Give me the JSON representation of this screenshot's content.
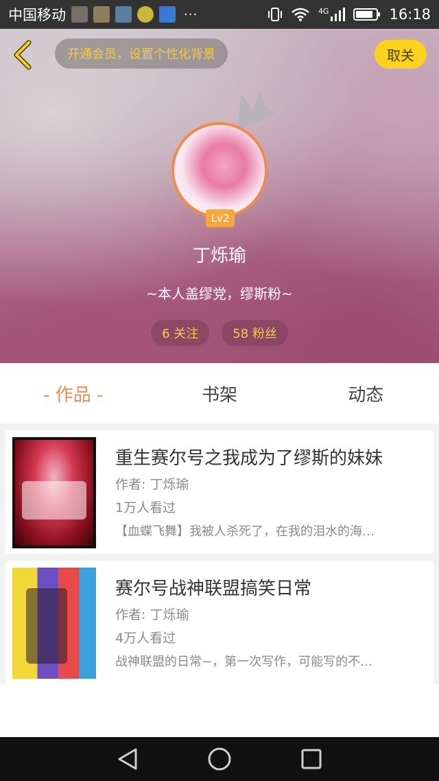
{
  "status_bar": {
    "carrier": "中国移动",
    "dots": "···",
    "network": "4G",
    "time": "16:18"
  },
  "header": {
    "vip_prompt": "开通会员，设置个性化背景",
    "follow_button": "取关",
    "level": "Lv2",
    "username": "丁烁瑜",
    "bio": "~本人盖缪党，缪斯粉~",
    "following": "6 关注",
    "fans": "58 粉丝"
  },
  "tabs": [
    {
      "label": "- 作品 -",
      "active": true
    },
    {
      "label": "书架",
      "active": false
    },
    {
      "label": "动态",
      "active": false
    }
  ],
  "books": [
    {
      "title": "重生赛尔号之我成为了缪斯的妹妹",
      "author": "作者: 丁烁瑜",
      "views": "1万人看过",
      "desc": "【血蝶飞舞】我被人杀死了，在我的泪水的海…"
    },
    {
      "title": "赛尔号战神联盟搞笑日常",
      "author": "作者: 丁烁瑜",
      "views": "4万人看过",
      "desc": "战神联盟的日常~，第一次写作，可能写的不…"
    }
  ],
  "colors": {
    "accent": "#f28a4b",
    "follow_button": "#fcd21c",
    "vip_text": "#f5cc3b"
  },
  "icons": {
    "back": "chevron-left-icon",
    "crown": "crown-icon",
    "nav_back": "triangle-back-icon",
    "nav_home": "circle-home-icon",
    "nav_recent": "square-recent-icon"
  }
}
